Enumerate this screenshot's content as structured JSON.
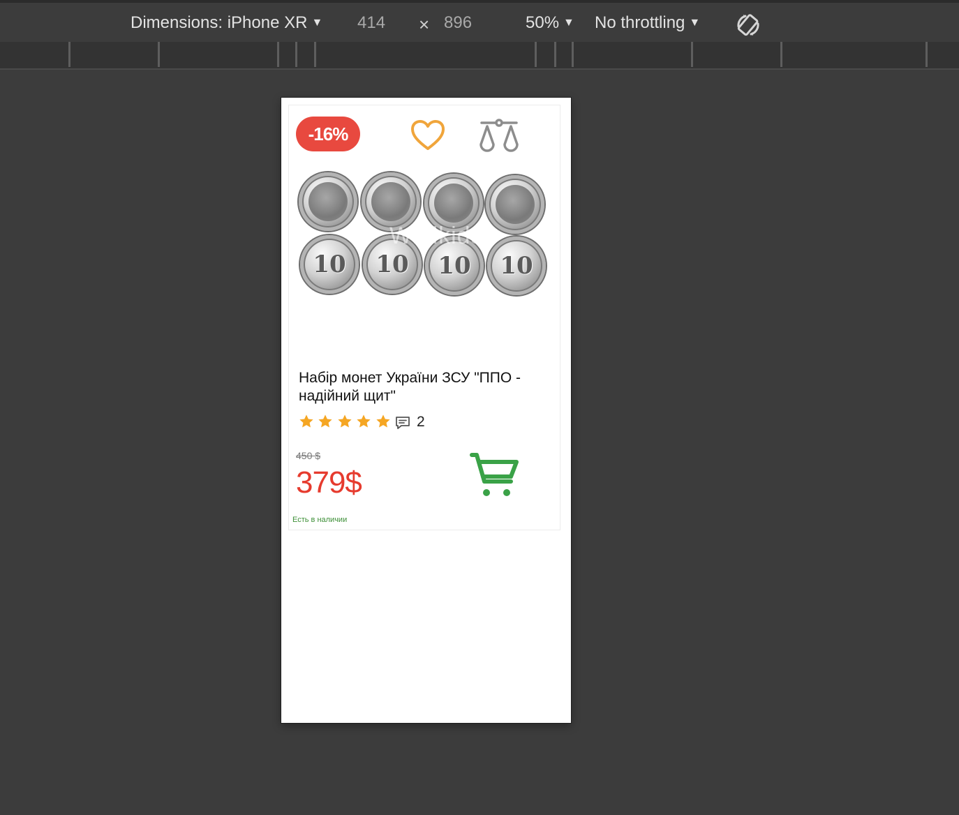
{
  "toolbar": {
    "dimensions_label": "Dimensions: iPhone XR",
    "width": "414",
    "times": "×",
    "height": "896",
    "zoom": "50%",
    "throttling": "No throttling",
    "rotate_icon": "rotate-device-icon"
  },
  "product": {
    "discount_badge": "-16%",
    "favorite_icon": "heart-icon",
    "compare_icon": "scales-icon",
    "image_watermark": "Wildkids",
    "title": "Набір монет України ЗСУ \"ППО - надійний щит\"",
    "rating": 5,
    "comments_count": "2",
    "old_price": "450 $",
    "price": "379$",
    "cart_icon": "cart-icon",
    "stock_status": "Есть в наличии"
  },
  "colors": {
    "discount": "#e8493f",
    "favorite": "#f0a53b",
    "stars": "#f5a623",
    "price": "#e63b2e",
    "cart": "#3aa247",
    "stock": "#3d8f37"
  }
}
